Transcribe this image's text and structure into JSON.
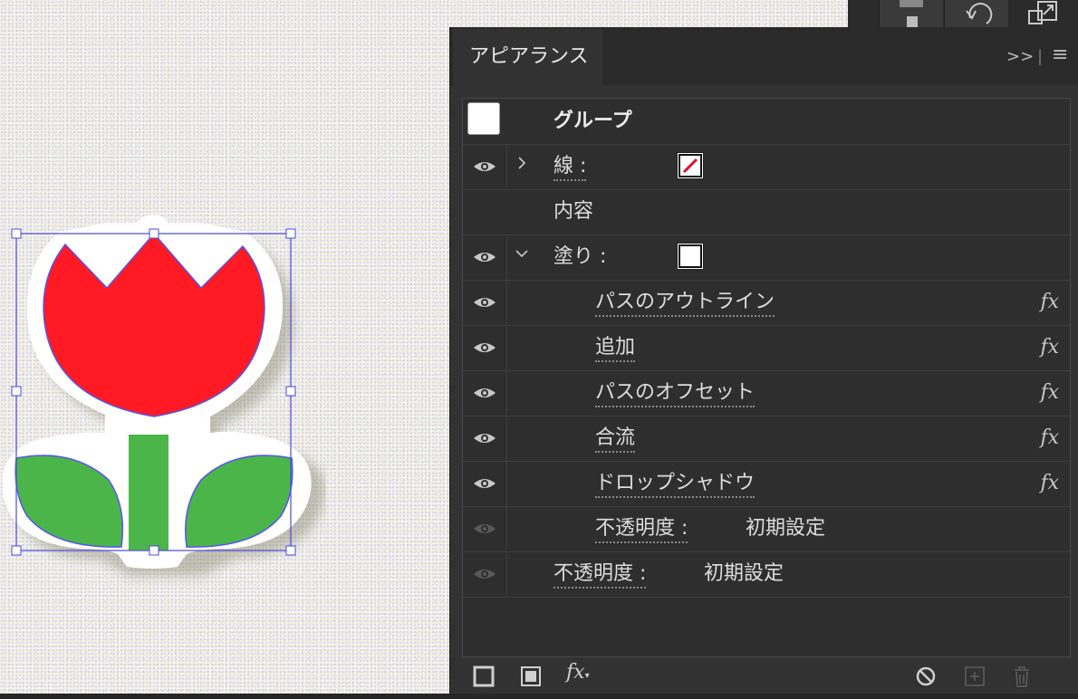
{
  "panel": {
    "tab_label": "アピアランス",
    "collapse_label": ">>",
    "menu_label": "≡"
  },
  "appearance": {
    "target": "グループ",
    "stroke_label": "線 :",
    "contents_label": "内容",
    "fill_label": "塗り :",
    "effects": [
      {
        "name": "パスのアウトライン",
        "fx": "fx"
      },
      {
        "name": "追加",
        "fx": "fx"
      },
      {
        "name": "パスのオフセット",
        "fx": "fx"
      },
      {
        "name": "合流",
        "fx": "fx"
      },
      {
        "name": "ドロップシャドウ",
        "fx": "fx"
      }
    ],
    "fill_opacity_label": "不透明度 :",
    "fill_opacity_value": "初期設定",
    "group_opacity_label": "不透明度 :",
    "group_opacity_value": "初期設定"
  },
  "footer": {
    "fx_label": "fx"
  },
  "icons": {
    "visibility": "eye-icon",
    "disclosure_closed": "chevron-right-icon",
    "disclosure_open": "chevron-down-icon",
    "stroke_none": "stroke-none-swatch",
    "fill_white": "fill-white-swatch"
  },
  "colors": {
    "panel_bg": "#323232",
    "tulip_red": "#ff1a24",
    "leaf_green": "#4cb549",
    "selection": "#4a4ae0"
  }
}
